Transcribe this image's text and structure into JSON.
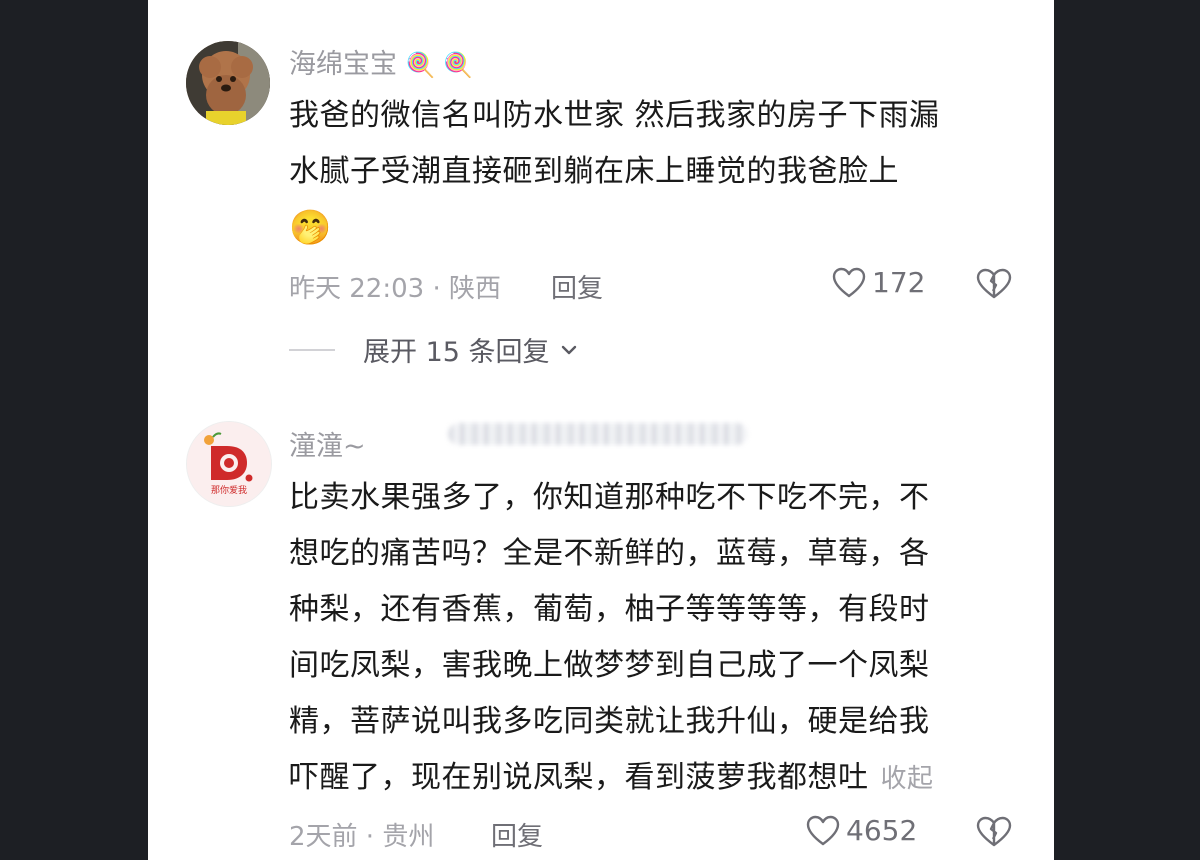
{
  "comments": [
    {
      "username": "海绵宝宝",
      "username_emojis": "🍭 🍭",
      "avatar_icon": "poodle-dog-avatar",
      "lines": [
        "我爸的微信名叫防水世家 然后我家的房子下雨漏",
        "水腻子受潮直接砸到躺在床上睡觉的我爸脸上"
      ],
      "trailing_emoji": "🤭",
      "time_location": "昨天 22:03 · 陕西",
      "reply_label": "回复",
      "likes": "172",
      "expand_label": "展开 15 条回复"
    },
    {
      "username": "潼潼~",
      "avatar_icon": "fruit-shop-logo-avatar",
      "avatar_caption": "那你爱我",
      "lines": [
        "比卖水果强多了，你知道那种吃不下吃不完，不",
        "想吃的痛苦吗？全是不新鲜的，蓝莓，草莓，各",
        "种梨，还有香蕉，葡萄，柚子等等等等，有段时",
        "间吃凤梨，害我晚上做梦梦到自己成了一个凤梨",
        "精，菩萨说叫我多吃同类就让我升仙，硬是给我",
        "吓醒了，现在别说凤梨，看到菠萝我都想吐"
      ],
      "collapse_label": "收起",
      "time_location": "2天前 · 贵州",
      "reply_label": "回复",
      "likes": "4652"
    }
  ],
  "colors": {
    "background": "#ffffff",
    "outer": "#1d1f24",
    "text": "#1a1a1a",
    "muted": "#a4a4aa"
  }
}
